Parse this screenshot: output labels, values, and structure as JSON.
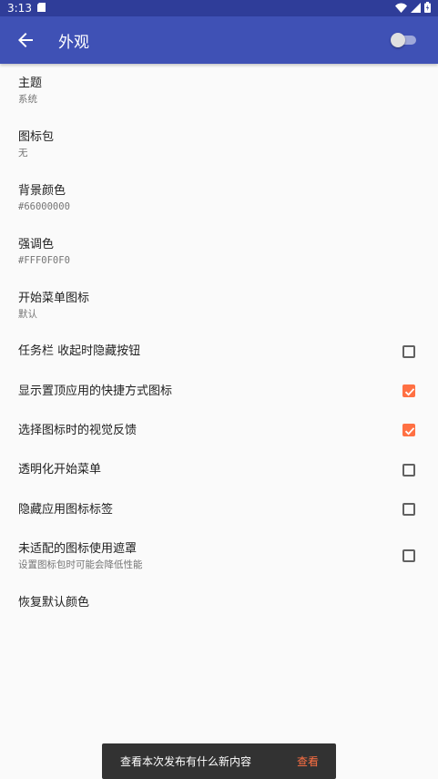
{
  "statusbar": {
    "time": "3:13"
  },
  "appbar": {
    "title": "外观"
  },
  "items": [
    {
      "title": "主题",
      "summary": "系统"
    },
    {
      "title": "图标包",
      "summary": "无"
    },
    {
      "title": "背景颜色",
      "summary": "#66000000"
    },
    {
      "title": "强调色",
      "summary": "#FFF0F0F0"
    },
    {
      "title": "开始菜单图标",
      "summary": "默认"
    }
  ],
  "checkboxes": [
    {
      "title": "任务栏 收起时隐藏按钮",
      "checked": false
    },
    {
      "title": "显示置顶应用的快捷方式图标",
      "checked": true
    },
    {
      "title": "选择图标时的视觉反馈",
      "checked": true
    },
    {
      "title": "透明化开始菜单",
      "checked": false
    },
    {
      "title": "隐藏应用图标标签",
      "checked": false
    },
    {
      "title": "未适配的图标使用遮罩",
      "summary": "设置图标包时可能会降低性能",
      "checked": false
    }
  ],
  "reset": {
    "title": "恢复默认颜色"
  },
  "snackbar": {
    "message": "查看本次发布有什么新内容",
    "action": "查看"
  },
  "colors": {
    "primary": "#3f51b5",
    "statusbar": "#2f3d99",
    "accent": "#ff7043"
  }
}
